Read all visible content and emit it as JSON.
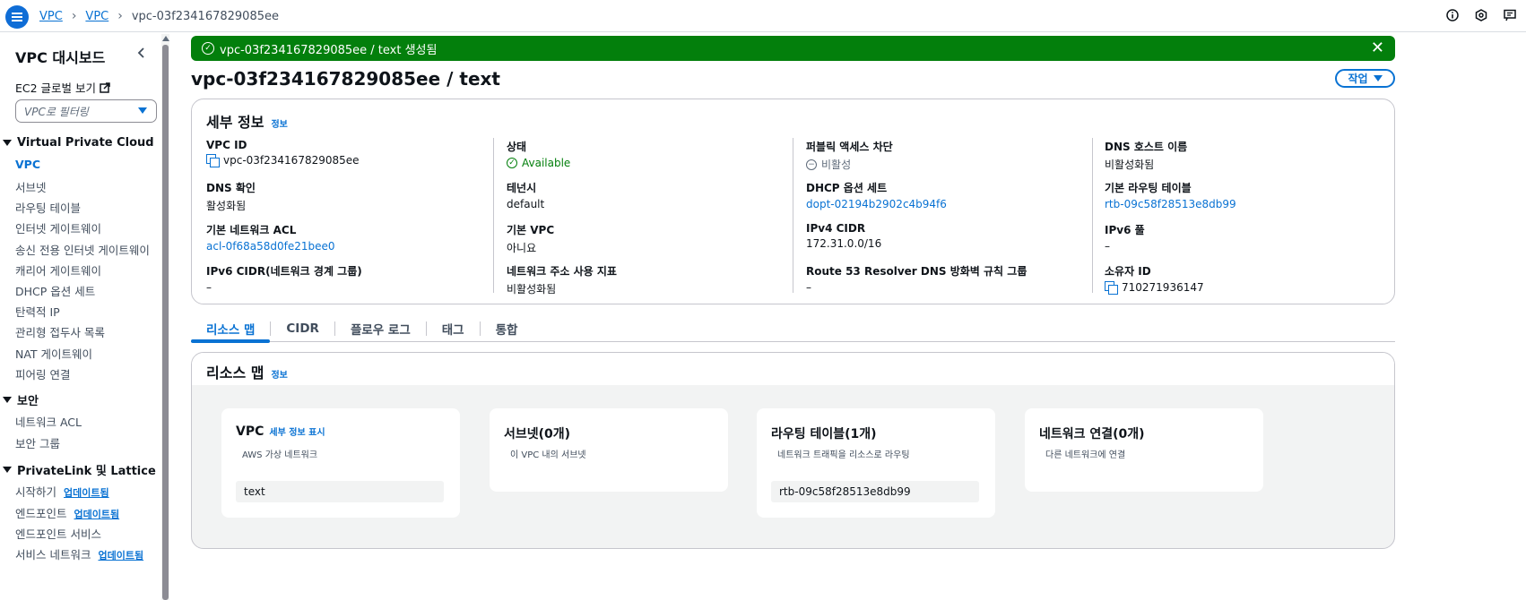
{
  "breadcrumb": [
    "VPC",
    "VPC",
    "vpc-03f234167829085ee"
  ],
  "sidebar": {
    "title": "VPC 대시보드",
    "ec2_link": "EC2 글로벌 보기",
    "filter_placeholder": "VPC로 필터링",
    "sections": [
      {
        "title": "Virtual Private Cloud",
        "items": [
          "VPC",
          "서브넷",
          "라우팅 테이블",
          "인터넷 게이트웨이",
          "송신 전용 인터넷 게이트웨이",
          "캐리어 게이트웨이",
          "DHCP 옵션 세트",
          "탄력적 IP",
          "관리형 접두사 목록",
          "NAT 게이트웨이",
          "피어링 연결"
        ]
      },
      {
        "title": "보안",
        "items": [
          "네트워크 ACL",
          "보안 그룹"
        ]
      },
      {
        "title": "PrivateLink 및 Lattice",
        "items": [
          "시작하기",
          "엔드포인트",
          "엔드포인트 서비스",
          "서비스 네트워크"
        ]
      }
    ],
    "badge": "업데이트됨"
  },
  "flash": {
    "message": "vpc-03f234167829085ee / text 생성됨"
  },
  "page": {
    "title": "vpc-03f234167829085ee / text",
    "action": "작업"
  },
  "details": {
    "heading": "세부 정보",
    "info": "정보",
    "fields": [
      {
        "k": "VPC ID",
        "v": "vpc-03f234167829085ee"
      },
      {
        "k": "상태",
        "v": "Available"
      },
      {
        "k": "퍼블릭 액세스 차단",
        "v": "비활성"
      },
      {
        "k": "DNS 호스트 이름",
        "v": "비활성화됨"
      },
      {
        "k": "DNS 확인",
        "v": "활성화됨"
      },
      {
        "k": "테넌시",
        "v": "default"
      },
      {
        "k": "DHCP 옵션 세트",
        "v": "dopt-02194b2902c4b94f6"
      },
      {
        "k": "기본 라우팅 테이블",
        "v": "rtb-09c58f28513e8db99"
      },
      {
        "k": "기본 네트워크 ACL",
        "v": "acl-0f68a58d0fe21bee0"
      },
      {
        "k": "기본 VPC",
        "v": "아니요"
      },
      {
        "k": "IPv4 CIDR",
        "v": "172.31.0.0/16"
      },
      {
        "k": "IPv6 풀",
        "v": "–"
      },
      {
        "k": "IPv6 CIDR(네트워크 경계 그룹)",
        "v": "–"
      },
      {
        "k": "네트워크 주소 사용 지표",
        "v": "비활성화됨"
      },
      {
        "k": "Route 53 Resolver DNS 방화벽 규칙 그룹",
        "v": "–"
      },
      {
        "k": "소유자 ID",
        "v": "710271936147"
      }
    ]
  },
  "tabs": [
    "리소스 맵",
    "CIDR",
    "플로우 로그",
    "태그",
    "통합"
  ],
  "resource_map": {
    "heading": "리소스 맵",
    "info": "정보",
    "cards": [
      {
        "title": "VPC",
        "more": "세부 정보 표시",
        "desc": "AWS 가상 네트워크",
        "chip": "text"
      },
      {
        "title": "서브넷(0개)",
        "desc": "이 VPC 내의 서브넷",
        "chip": ""
      },
      {
        "title": "라우팅 테이블(1개)",
        "desc": "네트워크 트래픽을 리소스로 라우팅",
        "chip": "rtb-09c58f28513e8db99"
      },
      {
        "title": "네트워크 연결(0개)",
        "desc": "다른 네트워크에 연결",
        "chip": ""
      }
    ]
  },
  "colors": {
    "accent": "#0972d3",
    "success": "#037f0c",
    "brand_menu": "#0f6dd6"
  }
}
